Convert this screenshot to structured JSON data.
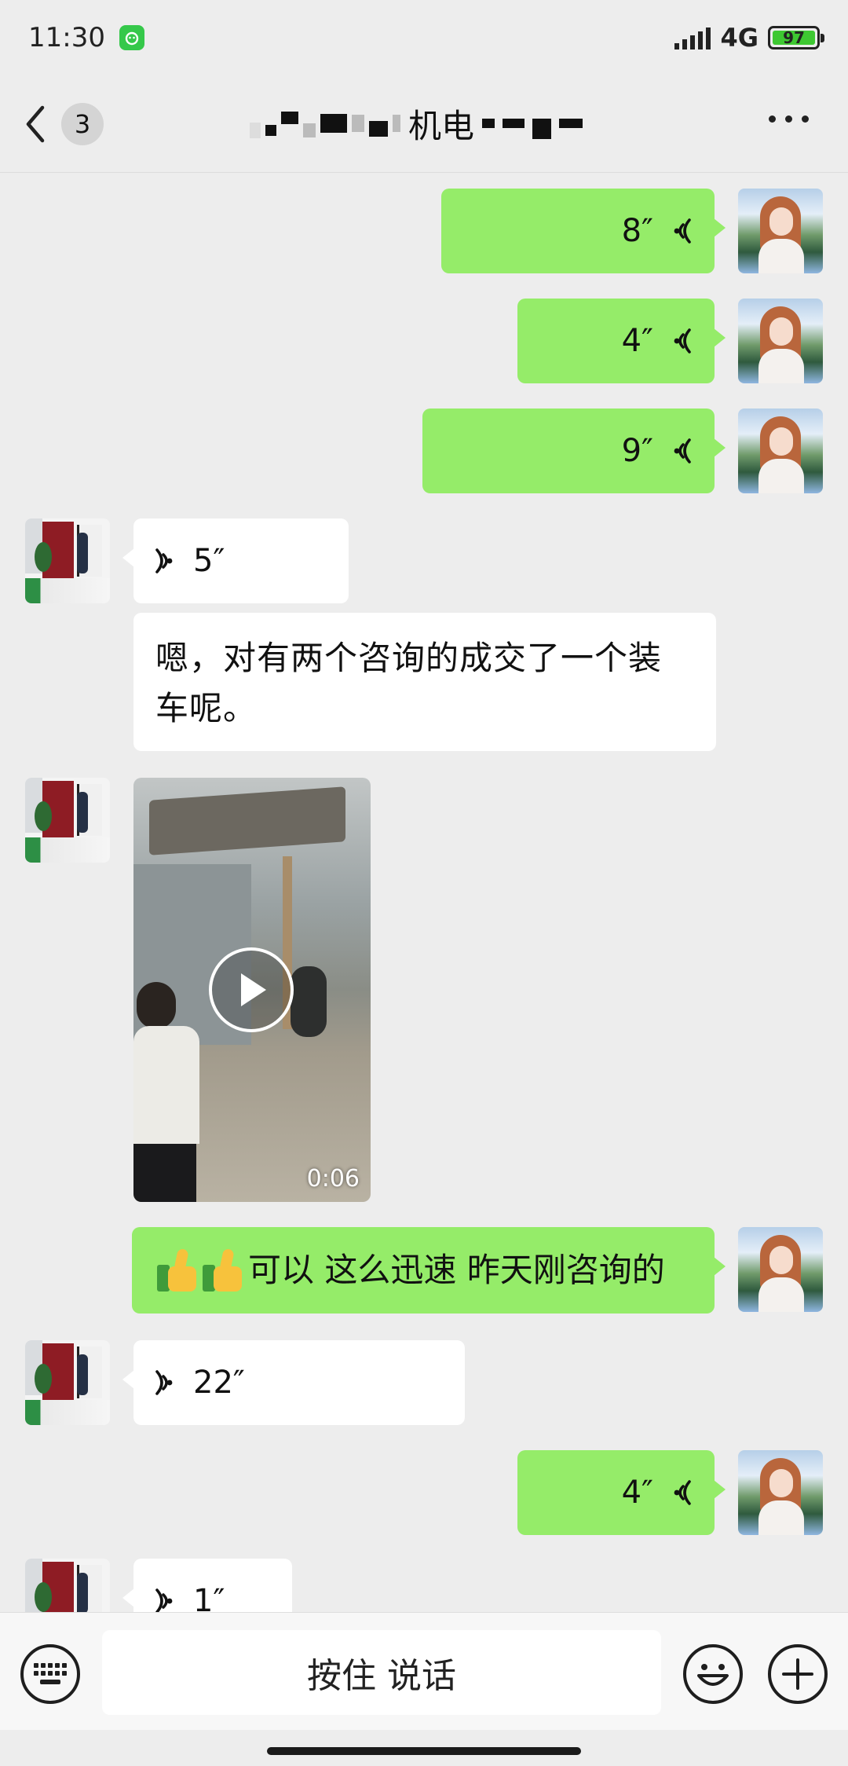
{
  "status_bar": {
    "time": "11:30",
    "network": "4G",
    "battery": "97",
    "accent_green": "#3ec832"
  },
  "nav": {
    "unread_count": "3",
    "title_visible": "机电",
    "back_icon": "chevron-left-icon",
    "more_icon": "ellipsis-icon"
  },
  "colors": {
    "background": "#ededed",
    "my_bubble": "#95ec69",
    "their_bubble": "#ffffff"
  },
  "messages": [
    {
      "sender": "me",
      "type": "voice",
      "duration": "8″"
    },
    {
      "sender": "me",
      "type": "voice",
      "duration": "4″"
    },
    {
      "sender": "me",
      "type": "voice",
      "duration": "9″"
    },
    {
      "sender": "them",
      "type": "voice",
      "duration": "5″"
    },
    {
      "sender": "them",
      "type": "text",
      "text": "嗯，对有两个咨询的成交了一个装车呢。"
    },
    {
      "sender": "them",
      "type": "video",
      "duration": "0:06"
    },
    {
      "sender": "me",
      "type": "text",
      "text": "可以 这么迅速 昨天刚咨询的",
      "emoji": "thumbs-up-icon"
    },
    {
      "sender": "them",
      "type": "voice",
      "duration": "22″"
    },
    {
      "sender": "me",
      "type": "voice",
      "duration": "4″"
    },
    {
      "sender": "them",
      "type": "voice",
      "duration": "1″"
    }
  ],
  "input_bar": {
    "hold_to_talk_label": "按住 说话",
    "keyboard_icon": "keyboard-icon",
    "emoji_icon": "smiley-icon",
    "plus_icon": "plus-icon"
  }
}
